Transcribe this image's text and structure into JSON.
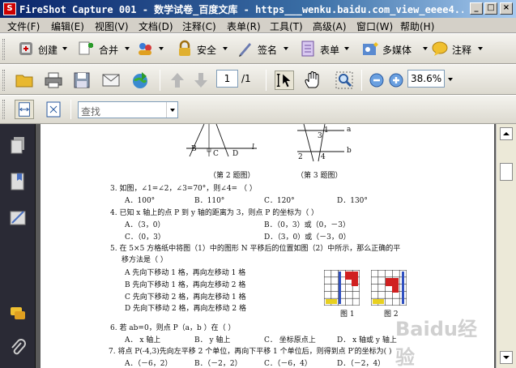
{
  "titlebar": {
    "app_icon": "S",
    "title": "FireShot Capture 001 - 数学试卷_百度文库 - https___wenku.baidu.com_view_eeee4..."
  },
  "window_buttons": {
    "minimize": "_",
    "maximize": "□",
    "close": "×"
  },
  "menu": [
    "文件(F)",
    "编辑(E)",
    "视图(V)",
    "文档(D)",
    "注释(C)",
    "表单(R)",
    "工具(T)",
    "高级(A)",
    "窗口(W)",
    "帮助(H)"
  ],
  "toolbar1": {
    "create": "创建",
    "combine": "合并",
    "secure": "安全",
    "sign": "签名",
    "forms": "表单",
    "multimedia": "多媒体",
    "comment": "注释"
  },
  "navigation": {
    "page_number": "1",
    "page_total": "/1",
    "zoom": "38.6%"
  },
  "find": {
    "placeholder": "查找"
  },
  "icons": {
    "open": "folder-icon",
    "print": "printer-icon",
    "save": "floppy-icon",
    "email": "envelope-icon",
    "upload": "globe-arrow-icon",
    "prev": "arrow-up-icon",
    "next": "arrow-down-icon",
    "select": "select-cursor-icon",
    "hand": "hand-icon",
    "zoom_tool": "magnifier-icon",
    "zoom_out": "zoom-out-icon",
    "zoom_in": "zoom-in-icon"
  },
  "document": {
    "caption_fig2": "（第 2 题图）",
    "caption_fig3": "（第 3 题图）",
    "q3": "3.  如图，∠1=∠2，∠3=70°，则∠4=  （          ）",
    "q3_opts": [
      "A．100°",
      "B．110°",
      "C．120°",
      "D．130°"
    ],
    "q4": "4.  已知 x 轴上的点 P 到 y 轴的距离为 3，则点 P 的坐标为（          ）",
    "q4_opts": [
      "A．（3，0）",
      "B．（0，3）或（0，－3）",
      "C．（0，3）",
      "D．（3，0）或（－3，0）"
    ],
    "q5a": "5.  在 5×5 方格纸中将图（1）中的图形 N 平移后的位置如图（2）中所示，那么正确的平",
    "q5b": "移方法是（          ）",
    "q5_opts": [
      "A 先向下移动 1 格，再向左移动 1 格",
      "B 先向下移动 1 格，再向左移动 2 格",
      "C 先向下移动 2 格，再向左移动 1 格",
      "D 先向下移动 2 格，再向左移动 2 格"
    ],
    "fig_labels": [
      "图 1",
      "图 2"
    ],
    "q6": "6.  若 ab=0，则点 P（a，b ）在（          ）",
    "q6_opts": [
      "A． x 轴上",
      "B． y 轴上",
      "C． 坐标原点上",
      "D． x 轴或 y 轴上"
    ],
    "q7": "7. 将点 P(-4,3)先向左平移 2 个单位，再向下平移 1 个单位后，则得到点 P′的坐标为(          )",
    "q7_opts": [
      "A．（－6，2）",
      "B．（－2，2）",
      "C．（－6，4）",
      "D．（－2，4）"
    ],
    "diagram_labels": [
      "B",
      "C",
      "D",
      "l",
      "a",
      "b",
      "3",
      "2",
      "4",
      "1"
    ]
  },
  "watermark": "Baidu经验"
}
